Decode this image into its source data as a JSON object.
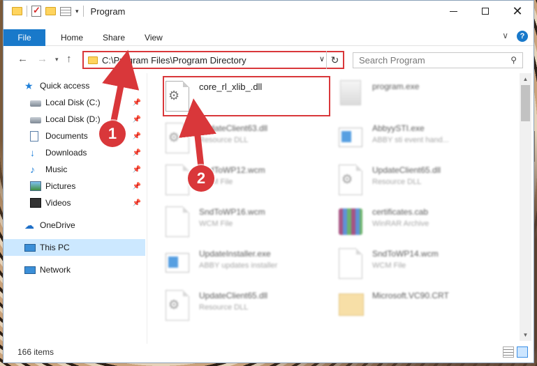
{
  "window": {
    "title": "Program"
  },
  "ribbon": {
    "tabs": [
      "File",
      "Home",
      "Share",
      "View"
    ],
    "expand_label": "∨",
    "help_label": "?"
  },
  "nav": {
    "address": "C:\\Program Files\\Program Directory",
    "search_placeholder": "Search Program"
  },
  "sidebar": {
    "items": [
      {
        "label": "Quick access"
      },
      {
        "label": "Local Disk (C:)"
      },
      {
        "label": "Local Disk (D:)"
      },
      {
        "label": "Documents"
      },
      {
        "label": "Downloads"
      },
      {
        "label": "Music"
      },
      {
        "label": "Pictures"
      },
      {
        "label": "Videos"
      },
      {
        "label": "OneDrive"
      },
      {
        "label": "This PC"
      },
      {
        "label": "Network"
      }
    ]
  },
  "files": [
    {
      "name": "core_rl_xlib_.dll",
      "type": ""
    },
    {
      "name": "program.exe",
      "type": ""
    },
    {
      "name": "UpdateClient63.dll",
      "type": "Resource DLL"
    },
    {
      "name": "AbbyySTI.exe",
      "type": "ABBY sti event hand..."
    },
    {
      "name": "SndToWP12.wcm",
      "type": "WCM File"
    },
    {
      "name": "UpdateClient65.dll",
      "type": "Resource DLL"
    },
    {
      "name": "SndToWP16.wcm",
      "type": "WCM File"
    },
    {
      "name": "certificates.cab",
      "type": "WinRAR Archive"
    },
    {
      "name": "UpdateInstaller.exe",
      "type": "ABBY updates installer"
    },
    {
      "name": "SndToWP14.wcm",
      "type": "WCM File"
    },
    {
      "name": "UpdateClient65.dll",
      "type": "Resource DLL"
    },
    {
      "name": "Microsoft.VC90.CRT",
      "type": ""
    }
  ],
  "status": {
    "item_count": "166 items"
  },
  "annotations": {
    "step1": "1",
    "step2": "2"
  },
  "colors": {
    "accent": "#1979ca",
    "highlight": "#d9373a",
    "selected": "#cce8ff"
  }
}
